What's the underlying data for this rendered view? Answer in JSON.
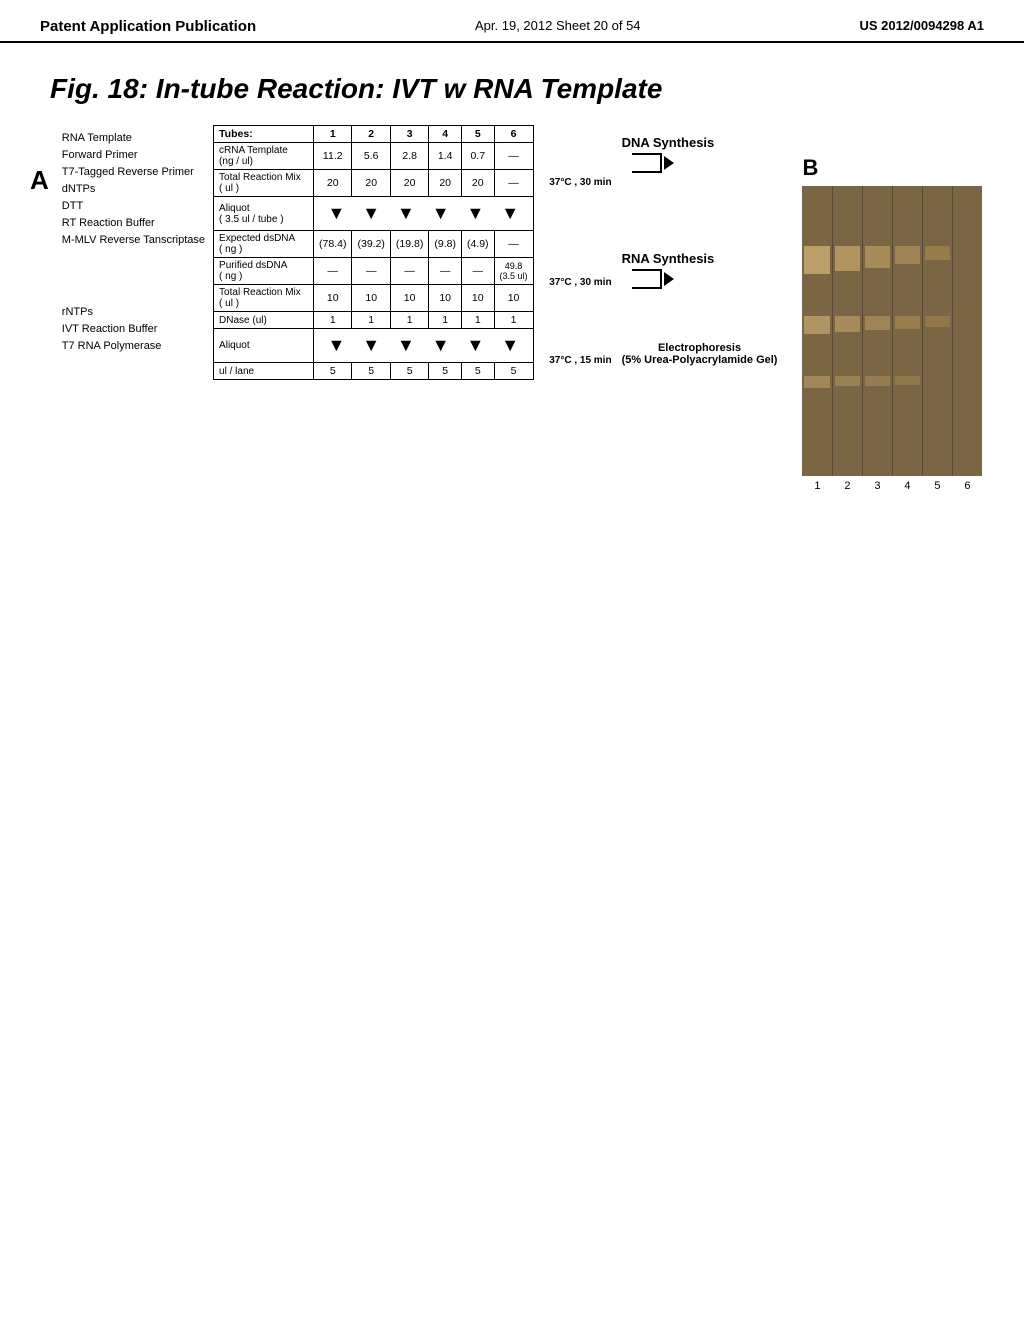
{
  "header": {
    "left": "Patent Application Publication",
    "center": "Apr. 19, 2012  Sheet 20 of 54",
    "right": "US 2012/0094298 A1"
  },
  "figure": {
    "title": "Fig. 18: In-tube Reaction: IVT w RNA Template"
  },
  "section_a": {
    "label": "A",
    "reagents": [
      "RNA Template",
      "Forward Primer",
      "T7-Tagged Reverse Primer",
      "dNTPs",
      "DTT",
      "RT Reaction Buffer",
      "M-MLV Reverse Tanscriptase"
    ]
  },
  "table": {
    "columns": [
      "label",
      "1",
      "2",
      "3",
      "4",
      "5",
      "6"
    ],
    "row_tubes_header": "Tubes:",
    "rows": [
      {
        "label": "cRNA Template\n(ng / ul)",
        "values": [
          "11.2",
          "5.6",
          "2.8",
          "1.4",
          "0.7",
          "—"
        ]
      },
      {
        "label": "Total Reaction Mix\n( ul )",
        "values": [
          "20",
          "20",
          "20",
          "20",
          "20",
          "—"
        ]
      },
      {
        "label": "Aliquot\n( 3.5 ul / tube )",
        "values": [
          "",
          "",
          "",
          "",
          "",
          ""
        ]
      },
      {
        "label": "Expected dsDNA\n( ng )",
        "values": [
          "(78.4)",
          "(39.2)",
          "(19.8)",
          "(9.8)",
          "(4.9)",
          "—"
        ]
      },
      {
        "label": "Purified dsDNA\n( ng )",
        "values": [
          "—",
          "—",
          "—",
          "—",
          "—",
          "—"
        ]
      },
      {
        "label": "Total Reaction Mix\n( ul )",
        "values": [
          "10",
          "10",
          "10",
          "10",
          "10",
          "10"
        ]
      },
      {
        "label": "DNase (ul)",
        "values": [
          "1",
          "1",
          "1",
          "1",
          "1",
          "1"
        ]
      },
      {
        "label": "Aliquot",
        "values": [
          "",
          "",
          "",
          "",
          "",
          ""
        ]
      },
      {
        "label": "ul / lane",
        "values": [
          "5",
          "5",
          "5",
          "5",
          "5",
          "5"
        ]
      }
    ],
    "temp_label_dna": "37°C , 30 min",
    "temp_label_rna": "37°C , 30 min",
    "temp_label_dnase": "37°C , 15 min",
    "col6_special": "49.8\n(3.5 ul)"
  },
  "annotations": {
    "dna_synthesis": "DNA Synthesis",
    "rna_synthesis": "RNA Synthesis",
    "electrophoresis": "Electrophoresis\n(5% Urea-Polyacrylamide Gel)"
  },
  "section_b": {
    "label": "B",
    "lane_numbers": [
      "1",
      "2",
      "3",
      "4",
      "5",
      "6"
    ]
  },
  "additional_reagents": [
    "rNTPs",
    "IVT Reaction Buffer",
    "T7 RNA Polymerase"
  ]
}
